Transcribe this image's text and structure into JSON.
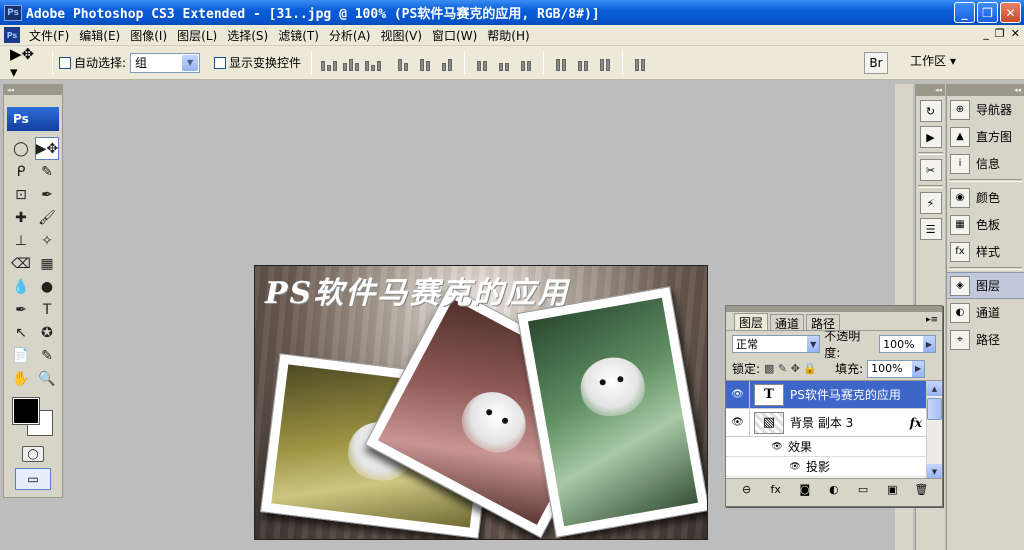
{
  "window": {
    "ps_badge": "Ps",
    "title": "Adobe Photoshop CS3 Extended - [31..jpg @ 100% (PS软件马赛克的应用, RGB/8#)]",
    "minimize": "_",
    "restore": "❐",
    "close": "✕"
  },
  "menubar": {
    "ps_badge": "Ps",
    "items": [
      "文件(F)",
      "编辑(E)",
      "图像(I)",
      "图层(L)",
      "选择(S)",
      "滤镜(T)",
      "分析(A)",
      "视图(V)",
      "窗口(W)",
      "帮助(H)"
    ],
    "mdi_min": "_",
    "mdi_restore": "❐",
    "mdi_close": "✕"
  },
  "options": {
    "tool_glyph": "▶✥ ▾",
    "auto_select_label": "自动选择:",
    "auto_select_value": "组",
    "show_transform_label": "显示变换控件",
    "workspace_label": "工作区 ▾",
    "bridge_glyph": "Br"
  },
  "tools": {
    "ps_logo": "Ps",
    "items": [
      "◯",
      "▶✥",
      "ᑭ",
      "✎",
      "⊡",
      "✒",
      "✚",
      "🖌",
      "⊥",
      "✧",
      "⌫",
      "▦",
      "💧",
      "●",
      "✒",
      "T",
      "↖",
      "✪",
      "📄",
      "✎",
      "✋",
      "🔍"
    ],
    "quickmask_glyph": "◯",
    "screenmode_glyph": "▭"
  },
  "canvas": {
    "title_text": "PS软件马赛克的应用"
  },
  "dock_icons": {
    "col1": [
      "↻",
      "▶",
      "✂",
      "⚡",
      "☰"
    ]
  },
  "dock_panels": {
    "items": [
      {
        "icon": "⊕",
        "label": "导航器"
      },
      {
        "icon": "▲",
        "label": "直方图"
      },
      {
        "icon": "i",
        "label": "信息"
      },
      {
        "icon": "◉",
        "label": "颜色"
      },
      {
        "icon": "▦",
        "label": "色板"
      },
      {
        "icon": "fx",
        "label": "样式"
      },
      {
        "icon": "◈",
        "label": "图层"
      },
      {
        "icon": "◐",
        "label": "通道"
      },
      {
        "icon": "⌖",
        "label": "路径"
      }
    ]
  },
  "layers_panel": {
    "tabs": [
      "图层",
      "通道",
      "路径"
    ],
    "menu_glyph": "▸≡",
    "blend_mode": "正常",
    "opacity_label": "不透明度:",
    "opacity_value": "100%",
    "lock_label": "锁定:",
    "lock_icons": "▩ ✎ ✥ 🔒",
    "fill_label": "填充:",
    "fill_value": "100%",
    "layers": [
      {
        "thumb": "T",
        "name": "PS软件马赛克的应用",
        "fx": "",
        "selected": true
      },
      {
        "thumb": "▧",
        "name": "背景 副本 3",
        "fx": "fx",
        "selected": false
      }
    ],
    "effects_label": "效果",
    "drop_shadow_label": "投影",
    "bottom_icons": [
      "⊖",
      "fx",
      "◙",
      "◐",
      "▭",
      "▣",
      "🗑"
    ]
  }
}
